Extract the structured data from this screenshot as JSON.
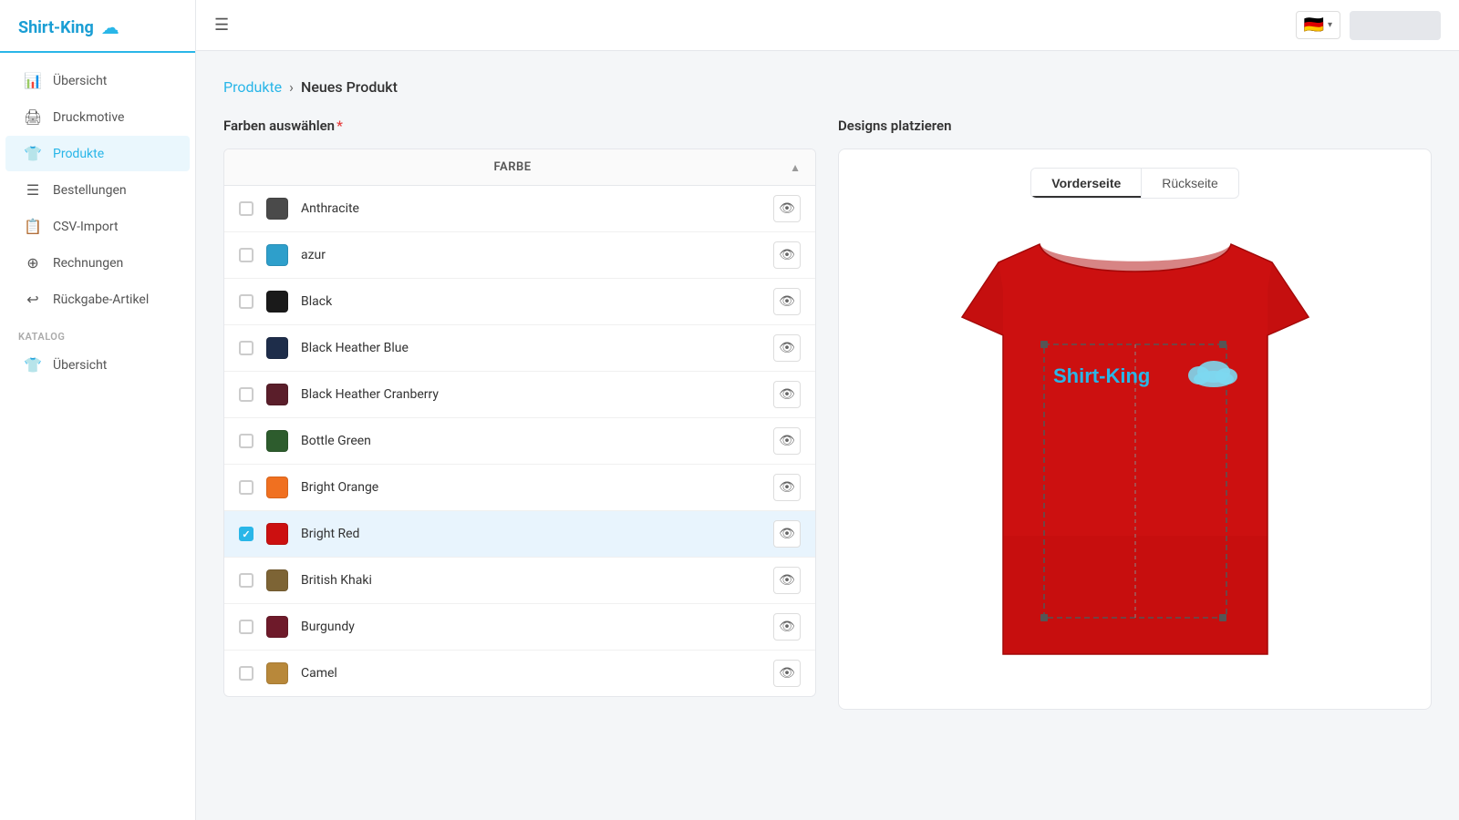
{
  "app": {
    "name": "Shirt-King",
    "logo_icon": "☁"
  },
  "sidebar": {
    "main_items": [
      {
        "id": "uebersicht",
        "label": "Übersicht",
        "icon": "📊",
        "active": false
      },
      {
        "id": "druckmotive",
        "label": "Druckmotive",
        "icon": "🖨",
        "active": false
      },
      {
        "id": "produkte",
        "label": "Produkte",
        "icon": "👕",
        "active": true
      },
      {
        "id": "bestellungen",
        "label": "Bestellungen",
        "icon": "☰",
        "active": false
      },
      {
        "id": "csv-import",
        "label": "CSV-Import",
        "icon": "📋",
        "active": false
      },
      {
        "id": "rechnungen",
        "label": "Rechnungen",
        "icon": "⊕",
        "active": false
      },
      {
        "id": "rueckgabe",
        "label": "Rückgabe-Artikel",
        "icon": "↩",
        "active": false
      }
    ],
    "katalog_label": "KATALOG",
    "katalog_items": [
      {
        "id": "katalog-uebersicht",
        "label": "Übersicht",
        "icon": "👕",
        "active": false
      }
    ]
  },
  "topbar": {
    "hamburger_icon": "☰",
    "flag": "🇩🇪"
  },
  "breadcrumb": {
    "link": "Produkte",
    "separator": "›",
    "current": "Neues Produkt"
  },
  "left_panel": {
    "title": "Farben auswählen",
    "required": "*",
    "column_label": "FARBE",
    "colors": [
      {
        "id": "anthracite",
        "name": "Anthracite",
        "swatch": "#4a4a4a",
        "selected": false
      },
      {
        "id": "azur",
        "name": "azur",
        "swatch": "#2e9fcb",
        "selected": false
      },
      {
        "id": "black",
        "name": "Black",
        "swatch": "#1a1a1a",
        "selected": false
      },
      {
        "id": "black-heather-blue",
        "name": "Black Heather Blue",
        "swatch": "#1e2d4a",
        "selected": false
      },
      {
        "id": "black-heather-cranberry",
        "name": "Black Heather Cranberry",
        "swatch": "#5a1e2a",
        "selected": false
      },
      {
        "id": "bottle-green",
        "name": "Bottle Green",
        "swatch": "#2d5c2d",
        "selected": false
      },
      {
        "id": "bright-orange",
        "name": "Bright Orange",
        "swatch": "#f07020",
        "selected": false
      },
      {
        "id": "bright-red",
        "name": "Bright Red",
        "swatch": "#cc1010",
        "selected": true
      },
      {
        "id": "british-khaki",
        "name": "British Khaki",
        "swatch": "#7d6435",
        "selected": false
      },
      {
        "id": "burgundy",
        "name": "Burgundy",
        "swatch": "#6e1a2a",
        "selected": false
      },
      {
        "id": "camel",
        "name": "Camel",
        "swatch": "#b8883a",
        "selected": false
      }
    ]
  },
  "right_panel": {
    "title": "Designs platzieren",
    "tabs": [
      {
        "id": "vorderseite",
        "label": "Vorderseite",
        "active": true
      },
      {
        "id": "rueckseite",
        "label": "Rückseite",
        "active": false
      }
    ],
    "shirt_color": "#cc1010",
    "logo_text": "Shirt-King",
    "logo_icon": "☁"
  }
}
